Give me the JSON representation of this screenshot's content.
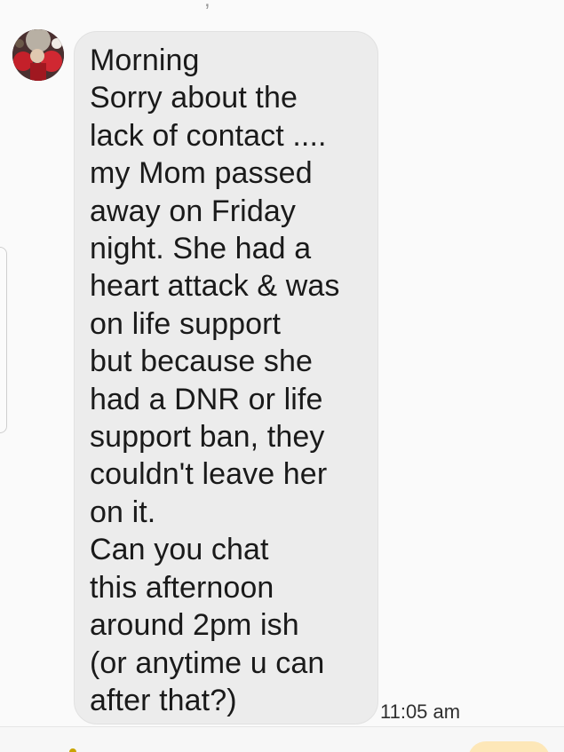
{
  "top_fragment": ",",
  "contact": {
    "avatar_icon": "contact-avatar-photo"
  },
  "message": {
    "lines": [
      "Morning",
      "Sorry about the",
      "lack of contact ....",
      "my Mom passed",
      "away on Friday",
      "night. She had a",
      "heart attack & was",
      "on life support",
      "but because she",
      "had a DNR or life",
      "support ban, they",
      "couldn't leave her",
      "on it.",
      "Can you chat",
      "this afternoon",
      "around 2pm ish",
      "(or anytime u can",
      "after that?)"
    ],
    "timestamp": "11:05 am"
  },
  "colors": {
    "bubble_background": "#ececec",
    "page_background": "#fafafa",
    "send_button": "#fde7b8"
  }
}
